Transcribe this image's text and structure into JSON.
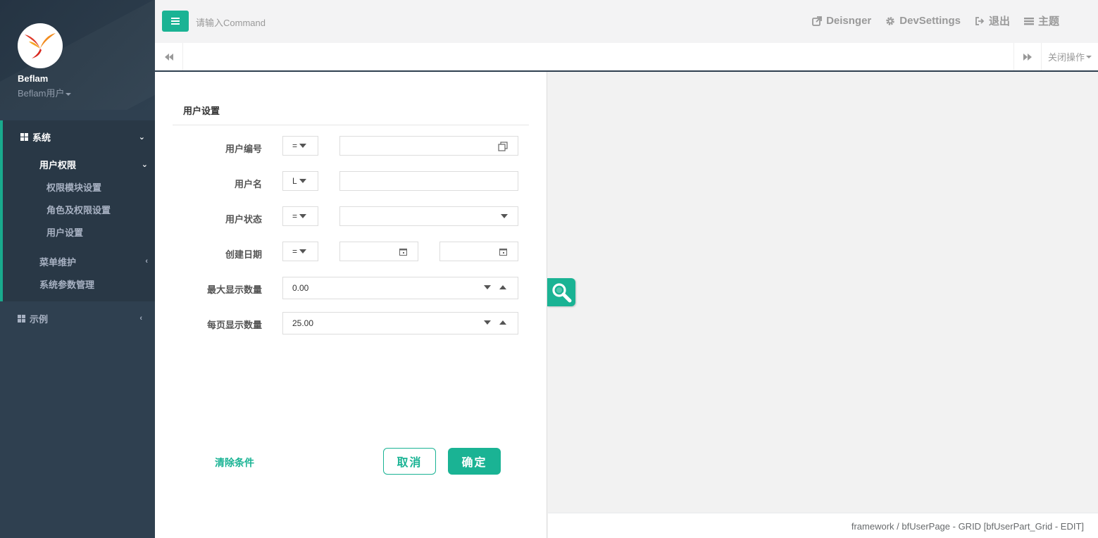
{
  "colors": {
    "accent": "#1ab394",
    "sidebar": "#2f4050",
    "sidebar_active": "#293846"
  },
  "profile": {
    "name": "Beflam",
    "role": "Beflam用户"
  },
  "sidebar": {
    "system": {
      "label": "系统",
      "chevron": "⌄"
    },
    "user_perm": {
      "label": "用户权限",
      "chevron": "⌄"
    },
    "perm_module": {
      "label": "权限模块设置"
    },
    "role_perm": {
      "label": "角色及权限设置"
    },
    "user_settings": {
      "label": "用户设置"
    },
    "menu_maint": {
      "label": "菜单维护",
      "chevron": "‹"
    },
    "sys_params": {
      "label": "系统参数管理"
    },
    "examples": {
      "label": "示例",
      "chevron": "‹"
    }
  },
  "topbar": {
    "command_placeholder": "请输入Command",
    "links": [
      {
        "label": "Deisnger",
        "icon": "external-link-icon"
      },
      {
        "label": "DevSettings",
        "icon": "gear-icon"
      },
      {
        "label": "退出",
        "icon": "sign-out-icon"
      },
      {
        "label": "主题",
        "icon": "list-icon"
      }
    ]
  },
  "tabs": {
    "close_ops": "关闭操作"
  },
  "form": {
    "title": "用户设置",
    "user_no": {
      "label": "用户编号",
      "op": "="
    },
    "user_name": {
      "label": "用户名",
      "op": "L"
    },
    "user_status": {
      "label": "用户状态",
      "op": "="
    },
    "create_date": {
      "label": "创建日期",
      "op": "="
    },
    "max_display": {
      "label": "最大显示数量",
      "value": "0.00"
    },
    "page_size": {
      "label": "每页显示数量",
      "value": "25.00"
    },
    "clear": "清除条件",
    "cancel": "取消",
    "ok": "确定"
  },
  "footer": {
    "text": "framework / bfUserPage - GRID [bfUserPart_Grid - EDIT]"
  }
}
